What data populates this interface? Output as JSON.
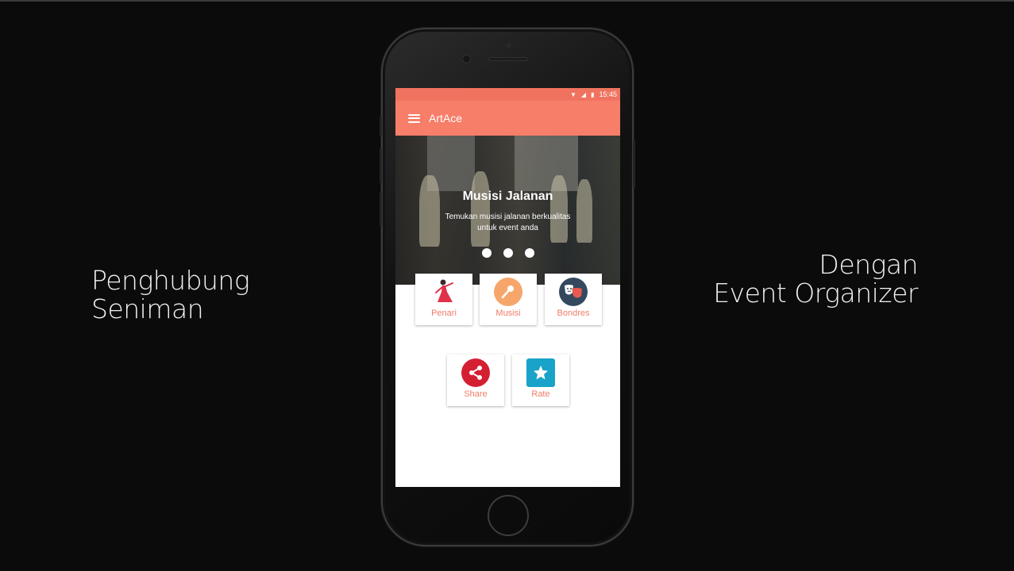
{
  "captions": {
    "left": [
      "Penghubung",
      "Seniman"
    ],
    "right": [
      "Dengan",
      "Event Organizer"
    ]
  },
  "status_bar": {
    "time": "15:45"
  },
  "app_bar": {
    "title": "ArtAce"
  },
  "hero": {
    "title": "Musisi Jalanan",
    "subtitle": "Temukan musisi jalanan berkualitas untuk event anda"
  },
  "categories": [
    {
      "label": "Penari",
      "icon": "dancer-icon",
      "color": "#ffffff"
    },
    {
      "label": "Musisi",
      "icon": "microphone-icon",
      "color": "#f6a66a"
    },
    {
      "label": "Bondres",
      "icon": "theater-masks-icon",
      "color": "#34495e"
    }
  ],
  "actions": [
    {
      "label": "Share",
      "icon": "share-icon",
      "color": "#d41f33"
    },
    {
      "label": "Rate",
      "icon": "star-icon",
      "color": "#1aa3c9"
    }
  ],
  "colors": {
    "appbar": "#f77e69",
    "statusbar": "#f0735f",
    "tile_label": "#f07c68"
  }
}
